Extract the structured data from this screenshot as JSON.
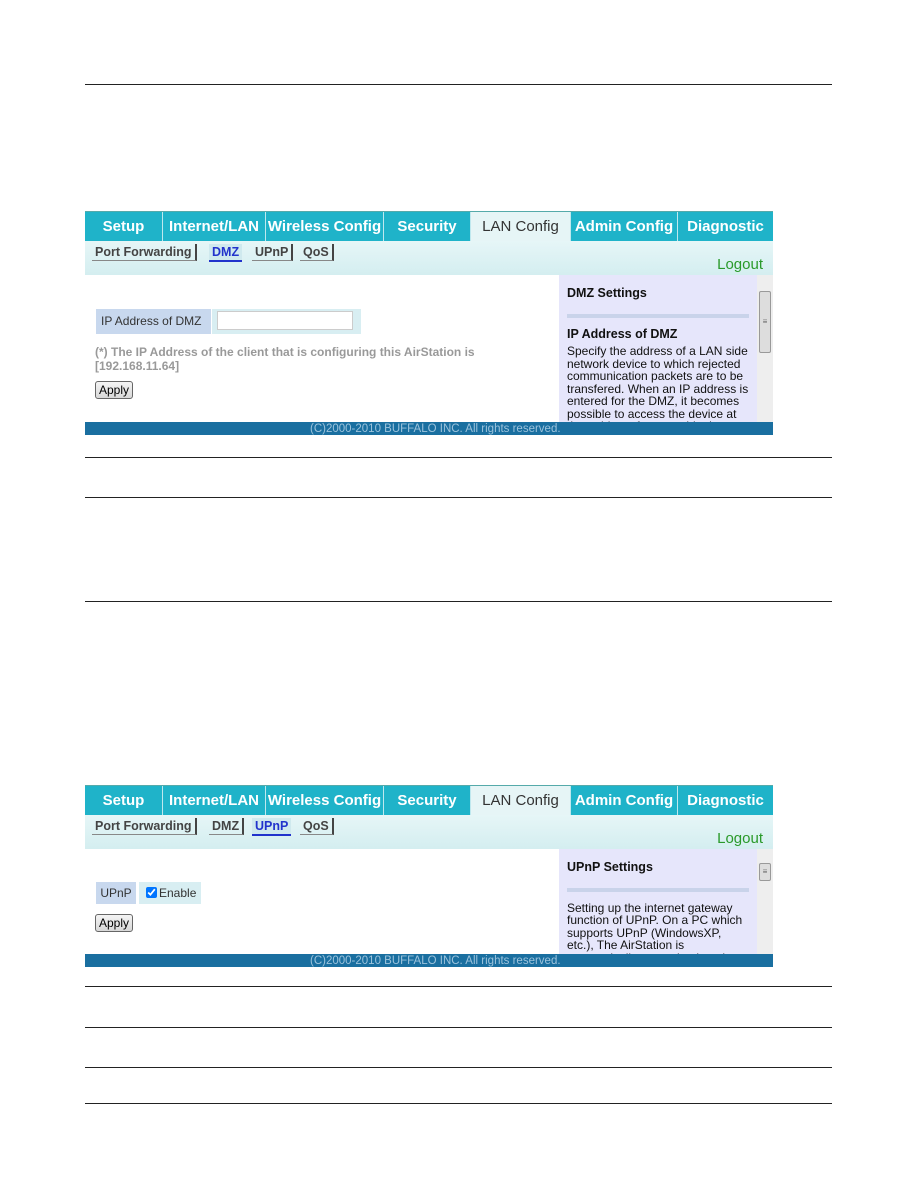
{
  "nav_tabs": [
    "Setup",
    "Internet/LAN",
    "Wireless Config",
    "Security",
    "LAN Config",
    "Admin Config",
    "Diagnostic"
  ],
  "sub_tabs": [
    "Port Forwarding",
    "DMZ",
    "UPnP",
    "QoS"
  ],
  "logout": "Logout",
  "footer": "(C)2000-2010 BUFFALO INC. All rights reserved.",
  "dmz": {
    "active_tab": "LAN Config",
    "active_subtab": "DMZ",
    "field_label": "IP Address of DMZ",
    "field_value": "",
    "note": "(*) The IP Address of the client that is configuring this AirStation is [192.168.11.64]",
    "apply": "Apply",
    "help_title": "DMZ Settings",
    "help_heading": "IP Address of DMZ",
    "help_text": "Specify the address of a LAN side network device to which rejected communication packets are to be transfered. When an IP address is entered for the DMZ, it becomes possible to access the device at that address from outside the"
  },
  "upnp": {
    "active_tab": "LAN Config",
    "active_subtab": "UPnP",
    "field_label": "UPnP",
    "checkbox_label": "Enable",
    "checked": true,
    "apply": "Apply",
    "help_title": "UPnP Settings",
    "help_text": "Setting up the internet gateway function of UPnP. On a PC which supports UPnP (WindowsXP, etc.), The AirStation is automatically recognized on the LANas an"
  },
  "colors": {
    "tab_bg": "#1fb3c9",
    "footer_bg": "#1a6fa0",
    "logout": "#2a9a2a",
    "help_bg": "#e6e6fb"
  }
}
